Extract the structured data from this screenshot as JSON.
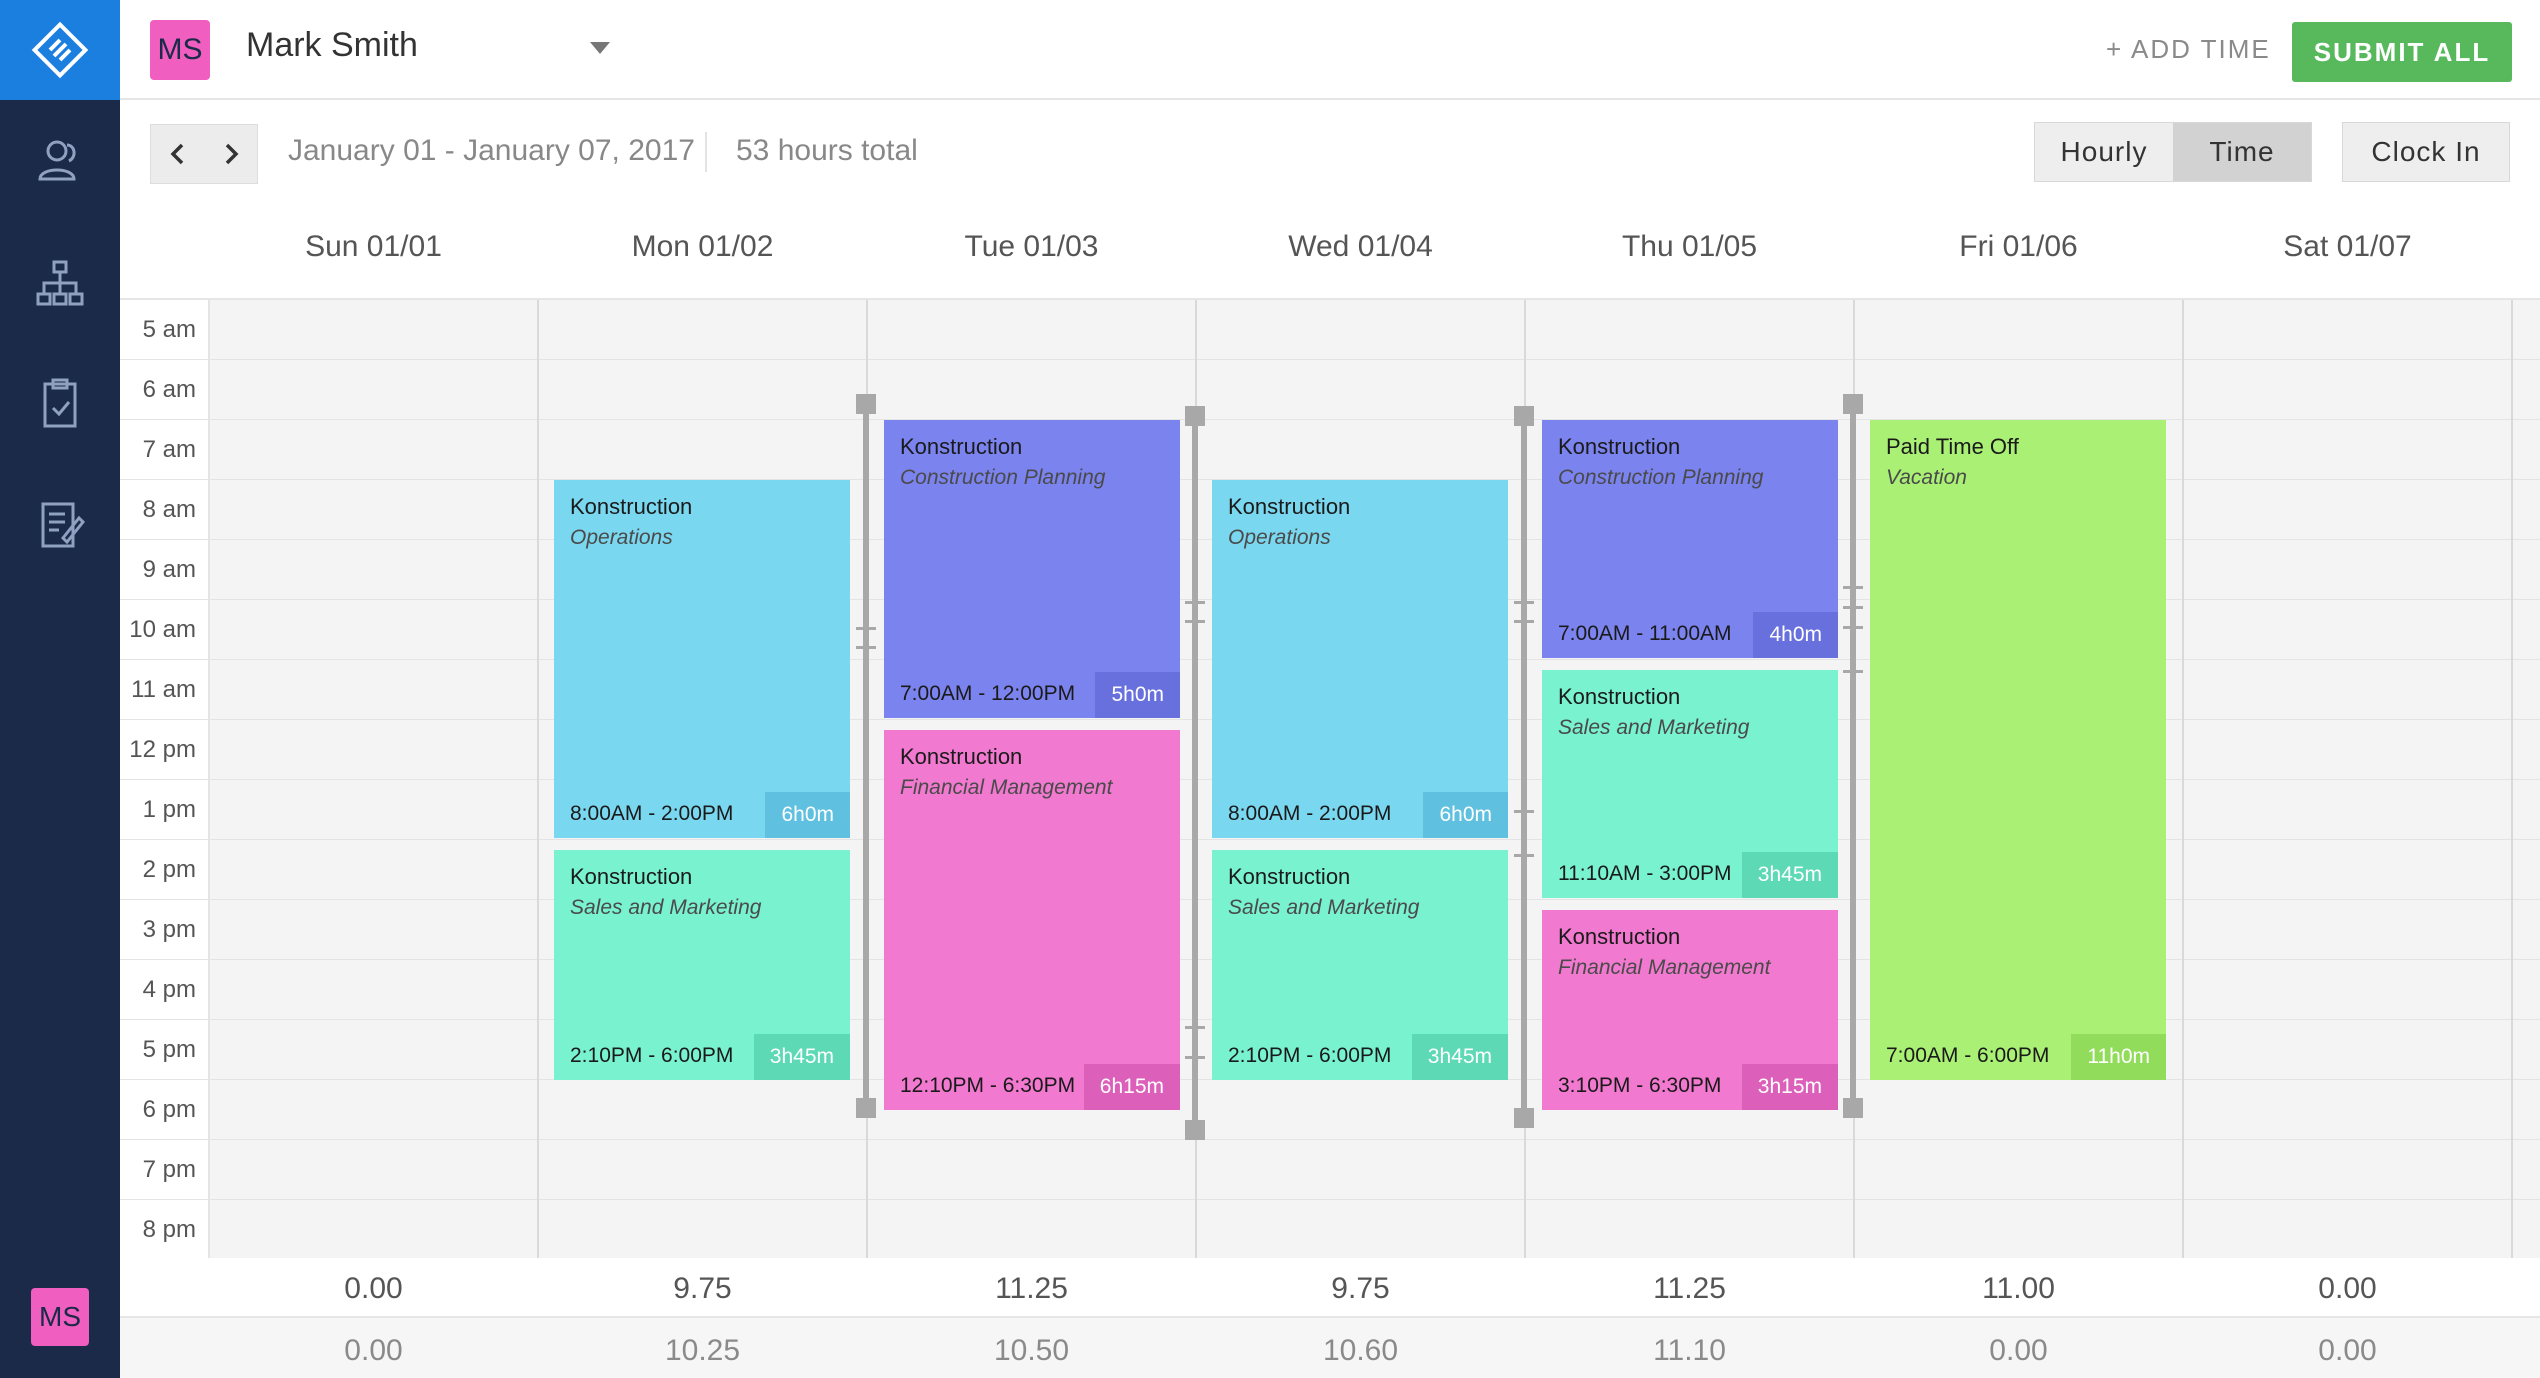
{
  "user": {
    "initials": "MS",
    "name": "Mark Smith"
  },
  "header": {
    "add_time": "+ ADD TIME",
    "submit_all": "SUBMIT ALL"
  },
  "toolbar": {
    "prev": "‹",
    "next": "›",
    "date_range": "January 01 - January 07, 2017",
    "hours_total": "53 hours total",
    "view_options": [
      "Hourly",
      "Time"
    ],
    "active_view": "Time",
    "clock_in": "Clock In"
  },
  "days": [
    "Sun 01/01",
    "Mon 01/02",
    "Tue 01/03",
    "Wed 01/04",
    "Thu 01/05",
    "Fri 01/06",
    "Sat 01/07"
  ],
  "hours": [
    "5 am",
    "6 am",
    "7 am",
    "8 am",
    "9 am",
    "10 am",
    "11 am",
    "12 pm",
    "1 pm",
    "2 pm",
    "3 pm",
    "4 pm",
    "5 pm",
    "6 pm",
    "7 pm",
    "8 pm"
  ],
  "events": [
    {
      "title": "Konstruction",
      "sub": "Operations",
      "time": "8:00AM - 2:00PM",
      "dur": "6h0m",
      "color": "blue"
    },
    {
      "title": "Konstruction",
      "sub": "Sales and Marketing",
      "time": "2:10PM - 6:00PM",
      "dur": "3h45m",
      "color": "teal"
    },
    {
      "title": "Konstruction",
      "sub": "Construction Planning",
      "time": "7:00AM - 12:00PM",
      "dur": "5h0m",
      "color": "purple"
    },
    {
      "title": "Konstruction",
      "sub": "Financial Management",
      "time": "12:10PM - 6:30PM",
      "dur": "6h15m",
      "color": "pink"
    },
    {
      "title": "Konstruction",
      "sub": "Operations",
      "time": "8:00AM - 2:00PM",
      "dur": "6h0m",
      "color": "blue"
    },
    {
      "title": "Konstruction",
      "sub": "Sales and Marketing",
      "time": "2:10PM - 6:00PM",
      "dur": "3h45m",
      "color": "teal"
    },
    {
      "title": "Konstruction",
      "sub": "Construction Planning",
      "time": "7:00AM - 11:00AM",
      "dur": "4h0m",
      "color": "purple"
    },
    {
      "title": "Konstruction",
      "sub": "Sales and Marketing",
      "time": "11:10AM - 3:00PM",
      "dur": "3h45m",
      "color": "teal"
    },
    {
      "title": "Konstruction",
      "sub": "Financial Management",
      "time": "3:10PM - 6:30PM",
      "dur": "3h15m",
      "color": "pink"
    },
    {
      "title": "Paid Time Off",
      "sub": "Vacation",
      "time": "7:00AM - 6:00PM",
      "dur": "11h0m",
      "color": "green"
    }
  ],
  "totals_primary": [
    "0.00",
    "9.75",
    "11.25",
    "9.75",
    "11.25",
    "11.00",
    "0.00"
  ],
  "totals_secondary": [
    "0.00",
    "10.25",
    "10.50",
    "10.60",
    "11.10",
    "0.00",
    "0.00"
  ],
  "colors": {
    "sidebar": "#1b2a48",
    "brand": "#1b7fe0",
    "submit": "#58b85c",
    "avatar": "#f05ec0"
  },
  "icons": [
    "logo-icon",
    "users-icon",
    "org-chart-icon",
    "clipboard-check-icon",
    "notes-edit-icon"
  ]
}
